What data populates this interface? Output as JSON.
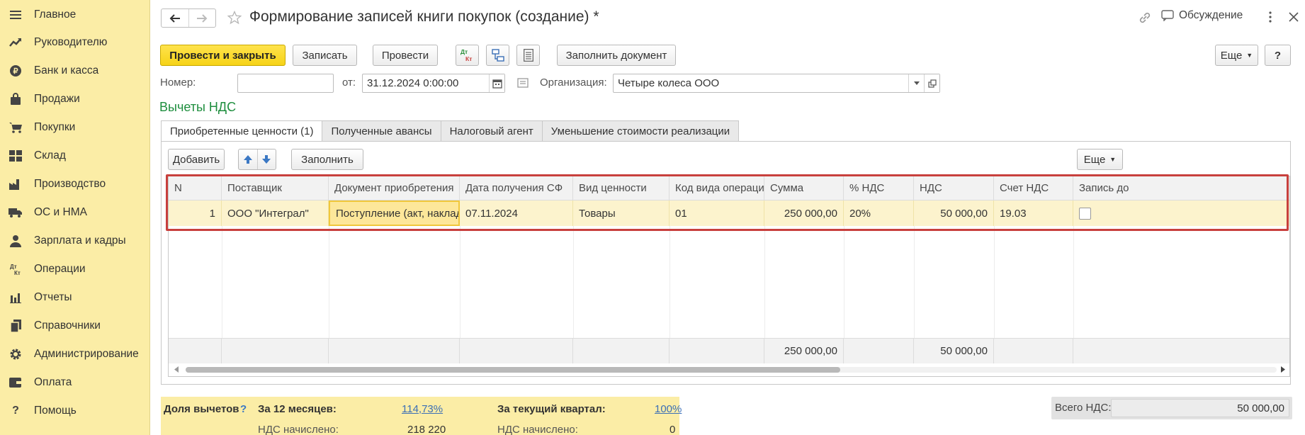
{
  "colors": {
    "sidebar_bg": "#fbeda6",
    "accent_yellow": "#f6d317",
    "section_green": "#1e8e3e",
    "highlight_red": "#c8403d",
    "row_bg": "#fcf3cd"
  },
  "sidebar": {
    "items": [
      {
        "label": "Главное",
        "icon": "menu-icon"
      },
      {
        "label": "Руководителю",
        "icon": "trend-icon"
      },
      {
        "label": "Банк и касса",
        "icon": "coin-icon"
      },
      {
        "label": "Продажи",
        "icon": "bag-icon"
      },
      {
        "label": "Покупки",
        "icon": "cart-icon"
      },
      {
        "label": "Склад",
        "icon": "warehouse-icon"
      },
      {
        "label": "Производство",
        "icon": "factory-icon"
      },
      {
        "label": "ОС и НМА",
        "icon": "truck-icon"
      },
      {
        "label": "Зарплата и кадры",
        "icon": "person-icon"
      },
      {
        "label": "Операции",
        "icon": "dt-kt-icon"
      },
      {
        "label": "Отчеты",
        "icon": "bar-chart-icon"
      },
      {
        "label": "Справочники",
        "icon": "books-icon"
      },
      {
        "label": "Администрирование",
        "icon": "gear-icon"
      },
      {
        "label": "Оплата",
        "icon": "wallet-icon"
      },
      {
        "label": "Помощь",
        "icon": "question-icon"
      }
    ]
  },
  "header": {
    "title": "Формирование записей книги покупок (создание) *",
    "discussion_label": "Обсуждение"
  },
  "toolbar": {
    "post_close": "Провести и закрыть",
    "save": "Записать",
    "post": "Провести",
    "dtkt_dt": "Дт",
    "dtkt_kt": "Кт",
    "fill_doc": "Заполнить документ",
    "more": "Еще",
    "help": "?"
  },
  "form": {
    "number_label": "Номер:",
    "number_value": "",
    "date_label": "от:",
    "date_value": "31.12.2024  0:00:00",
    "org_label": "Организация:",
    "org_value": "Четыре колеса ООО"
  },
  "section_title": "Вычеты НДС",
  "tabs": [
    {
      "label": "Приобретенные ценности (1)",
      "active": true
    },
    {
      "label": "Полученные авансы",
      "active": false
    },
    {
      "label": "Налоговый агент",
      "active": false
    },
    {
      "label": "Уменьшение стоимости реализации",
      "active": false
    }
  ],
  "table_toolbar": {
    "add": "Добавить",
    "fill": "Заполнить",
    "more": "Еще"
  },
  "table": {
    "columns": [
      "N",
      "Поставщик",
      "Документ приобретения",
      "Дата получения СФ",
      "Вид ценности",
      "Код вида операции",
      "Сумма",
      "% НДС",
      "НДС",
      "Счет НДС",
      "Запись до"
    ],
    "rows": [
      [
        "1",
        "ООО \"Интеграл\"",
        "Поступление (акт, наклад...",
        "07.11.2024",
        "Товары",
        "01",
        "250 000,00",
        "20%",
        "50 000,00",
        "19.03",
        ""
      ]
    ],
    "totals": {
      "sum": "250 000,00",
      "vat": "50 000,00"
    },
    "row_checked": false
  },
  "bottom": {
    "share_label": "Доля вычетов",
    "share_help": "?",
    "months12_label": "За 12 месяцев:",
    "months12_value": "114,73%",
    "quarter_label": "За текущий квартал:",
    "quarter_value": "100%",
    "vat_charged_label_1": "НДС начислено:",
    "vat_charged_value_1": "218 220",
    "vat_charged_label_2": "НДС начислено:",
    "vat_charged_value_2": "0",
    "total_vat_label": "Всего НДС:",
    "total_vat_value": "50 000,00"
  }
}
